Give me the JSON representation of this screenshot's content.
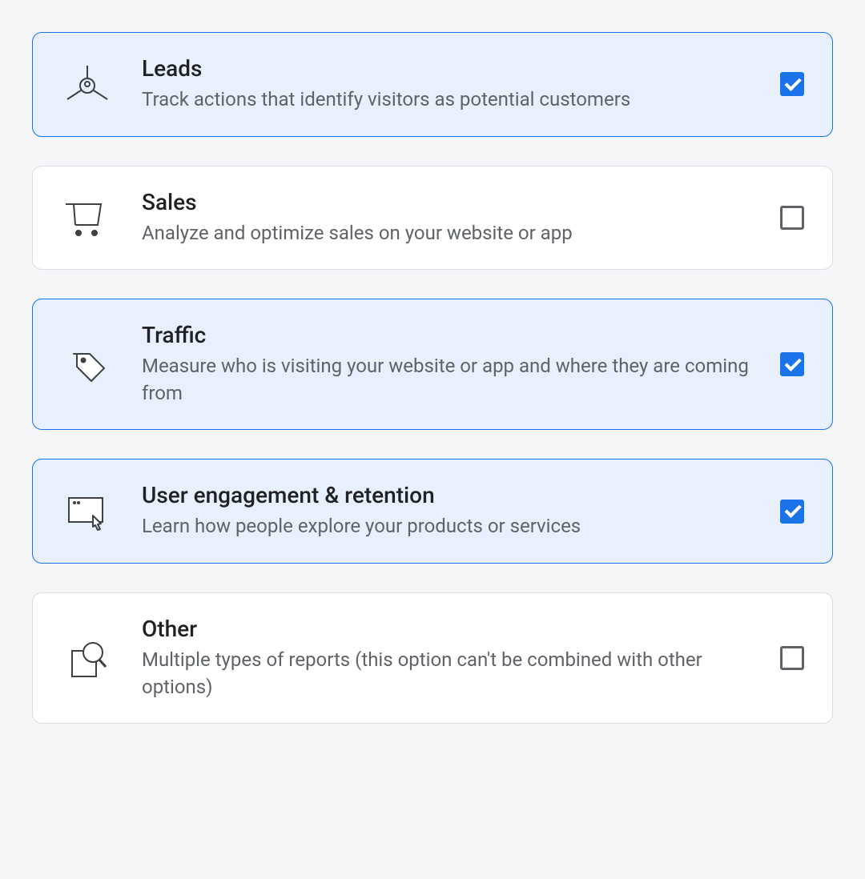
{
  "options": [
    {
      "id": "leads",
      "title": "Leads",
      "description": "Track actions that identify visitors as potential customers",
      "checked": true,
      "icon": "leads-icon"
    },
    {
      "id": "sales",
      "title": "Sales",
      "description": "Analyze and optimize sales on your website or app",
      "checked": false,
      "icon": "cart-icon"
    },
    {
      "id": "traffic",
      "title": "Traffic",
      "description": "Measure who is visiting your website or app and where they are coming from",
      "checked": true,
      "icon": "tag-icon"
    },
    {
      "id": "engagement",
      "title": "User engagement & retention",
      "description": "Learn how people explore your products or services",
      "checked": true,
      "icon": "pointer-icon"
    },
    {
      "id": "other",
      "title": "Other",
      "description": "Multiple types of reports (this option can't be combined with other options)",
      "checked": false,
      "icon": "search-doc-icon"
    }
  ]
}
